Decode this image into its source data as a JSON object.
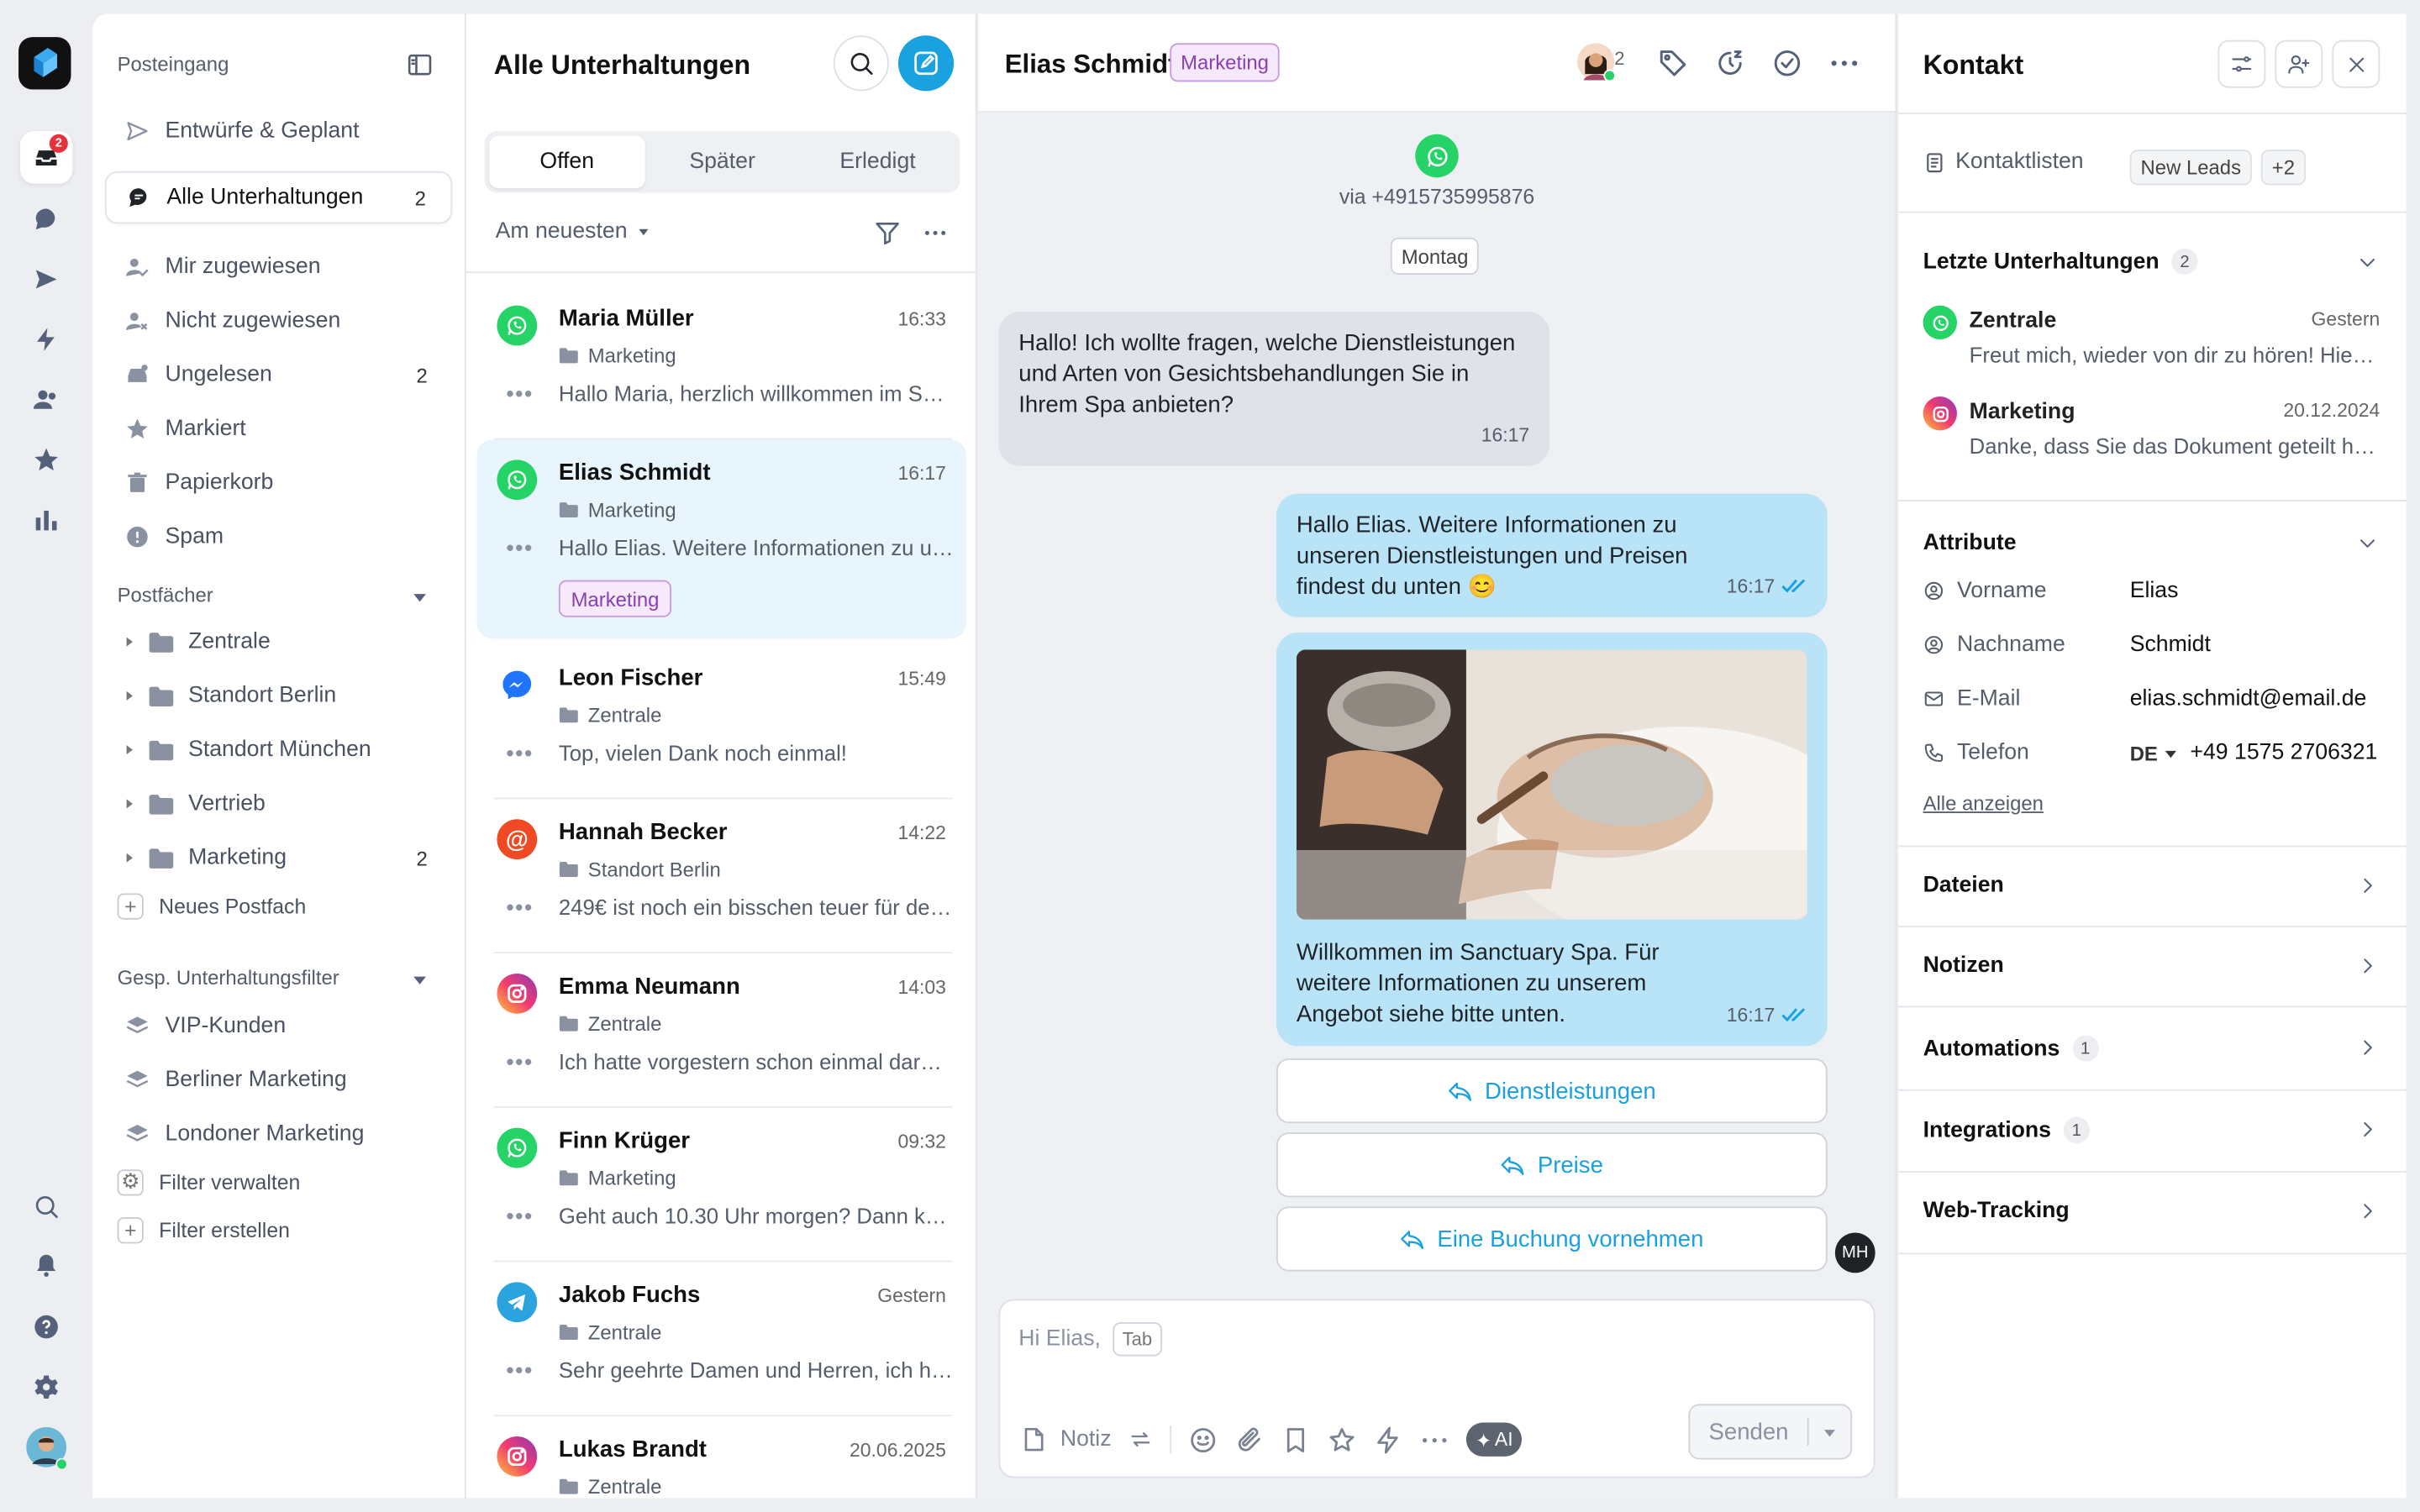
{
  "rail": {
    "badge": "2"
  },
  "sidebar": {
    "title": "Posteingang",
    "items": [
      {
        "label": "Entwürfe & Geplant",
        "count": ""
      },
      {
        "label": "Alle Unterhaltungen",
        "count": "2"
      },
      {
        "label": "Mir zugewiesen",
        "count": ""
      },
      {
        "label": "Nicht zugewiesen",
        "count": ""
      },
      {
        "label": "Ungelesen",
        "count": "2"
      },
      {
        "label": "Markiert",
        "count": ""
      },
      {
        "label": "Papierkorb",
        "count": ""
      },
      {
        "label": "Spam",
        "count": ""
      }
    ],
    "mailboxes_title": "Postfächer",
    "mailboxes": [
      {
        "label": "Zentrale",
        "count": ""
      },
      {
        "label": "Standort Berlin",
        "count": ""
      },
      {
        "label": "Standort München",
        "count": ""
      },
      {
        "label": "Vertrieb",
        "count": ""
      },
      {
        "label": "Marketing",
        "count": "2"
      }
    ],
    "new_mailbox": "Neues Postfach",
    "filters_title": "Gesp. Unterhaltungsfilter",
    "filters": [
      "VIP-Kunden",
      "Berliner Marketing",
      "Londoner Marketing"
    ],
    "manage_filters": "Filter verwalten",
    "create_filter": "Filter erstellen"
  },
  "list": {
    "title": "Alle Unterhaltungen",
    "tabs": [
      "Offen",
      "Später",
      "Erledigt"
    ],
    "sort": "Am neuesten",
    "conversations": [
      {
        "name": "Maria Müller",
        "time": "16:33",
        "inbox": "Marketing",
        "preview": "Hallo Maria, herzlich willkommen im Sea…",
        "channel": "whatsapp"
      },
      {
        "name": "Elias Schmidt",
        "time": "16:17",
        "inbox": "Marketing",
        "preview": "Hallo Elias. Weitere Informationen zu uns…",
        "channel": "whatsapp",
        "tag": "Marketing"
      },
      {
        "name": "Leon Fischer",
        "time": "15:49",
        "inbox": "Zentrale",
        "preview": "Top, vielen Dank noch einmal!",
        "channel": "messenger"
      },
      {
        "name": "Hannah Becker",
        "time": "14:22",
        "inbox": "Standort Berlin",
        "preview": "249€ ist noch ein bisschen teuer für den…",
        "channel": "email"
      },
      {
        "name": "Emma Neumann",
        "time": "14:03",
        "inbox": "Zentrale",
        "preview": "Ich hatte vorgestern schon einmal darüber…",
        "channel": "instagram"
      },
      {
        "name": "Finn Krüger",
        "time": "09:32",
        "inbox": "Marketing",
        "preview": "Geht auch 10.30 Uhr morgen? Dann könnte…",
        "channel": "whatsapp"
      },
      {
        "name": "Jakob Fuchs",
        "time": "Gestern",
        "inbox": "Zentrale",
        "preview": "Sehr geehrte Damen und Herren, ich hätte…",
        "channel": "telegram"
      },
      {
        "name": "Lukas Brandt",
        "time": "20.06.2025",
        "inbox": "Zentrale",
        "preview": "",
        "channel": "instagram"
      }
    ]
  },
  "chat": {
    "name": "Elias Schmidt",
    "tag": "Marketing",
    "agents_count": "2",
    "via": "via +4915735995876",
    "day": "Montag",
    "messages": [
      {
        "text": "Hallo! Ich wollte fragen, welche Dienstleistungen und Arten von Gesichtsbehandlungen Sie in Ihrem Spa anbieten?",
        "time": "16:17"
      },
      {
        "text": "Hallo Elias. Weitere Informationen zu unseren Dienstleistungen und Preisen findest du unten 😊",
        "time": "16:17"
      },
      {
        "text": "Willkommen im Sanctuary Spa. Für weitere Informationen zu unserem Angebot siehe bitte unten.",
        "time": "16:17"
      }
    ],
    "quick_replies": [
      "Dienstleistungen",
      "Preise",
      "Eine Buchung vornehmen"
    ],
    "agent_initials": "MH",
    "composer": {
      "placeholder": "Hi Elias,",
      "tab_hint": "Tab",
      "note": "Notiz",
      "ai": "AI",
      "send": "Senden"
    }
  },
  "contact": {
    "title": "Kontakt",
    "lists_label": "Kontaktlisten",
    "lists_chip": "New Leads",
    "lists_more": "+2",
    "recent_title": "Letzte Unterhaltungen",
    "recent_count": "2",
    "recent": [
      {
        "name": "Zentrale",
        "date": "Gestern",
        "preview": "Freut mich, wieder von dir zu hören! Hier ist…"
      },
      {
        "name": "Marketing",
        "date": "20.12.2024",
        "preview": "Danke, dass Sie das Dokument geteilt haben…"
      }
    ],
    "attributes_title": "Attribute",
    "attributes": [
      {
        "key": "Vorname",
        "value": "Elias"
      },
      {
        "key": "Nachname",
        "value": "Schmidt"
      },
      {
        "key": "E-Mail",
        "value": "elias.schmidt@email.de"
      },
      {
        "key": "Telefon",
        "value": "+49 1575 2706321",
        "country": "DE"
      }
    ],
    "show_all": "Alle anzeigen",
    "sections": [
      {
        "label": "Dateien",
        "count": ""
      },
      {
        "label": "Notizen",
        "count": ""
      },
      {
        "label": "Automations",
        "count": "1"
      },
      {
        "label": "Integrations",
        "count": "1"
      },
      {
        "label": "Web-Tracking",
        "count": ""
      }
    ]
  },
  "colors": {
    "accent": "#1aa1e0",
    "whatsapp": "#25d366",
    "tag_purple": "#8a3fb3",
    "badge_red": "#e5323b"
  }
}
